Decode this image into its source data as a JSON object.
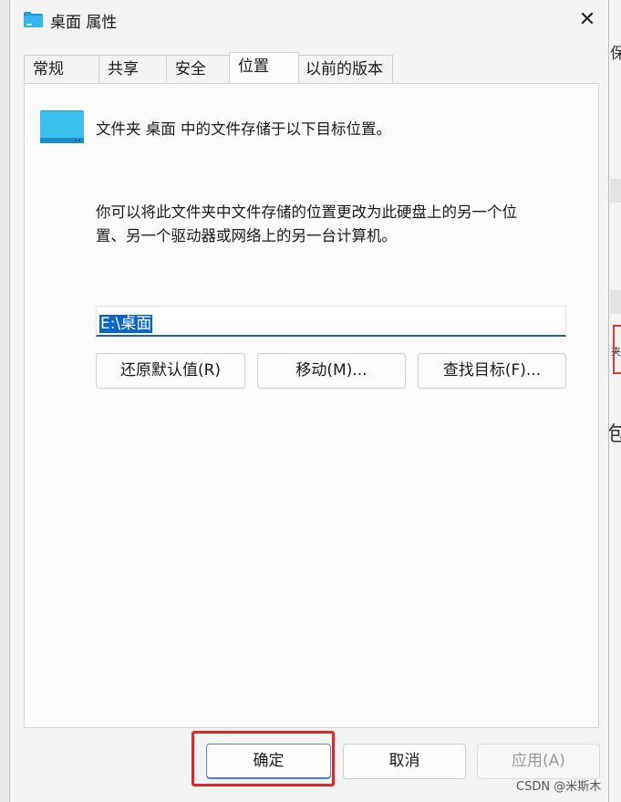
{
  "window": {
    "title": "桌面 属性",
    "close_symbol": "✕"
  },
  "tabs": [
    {
      "label": "常规"
    },
    {
      "label": "共享"
    },
    {
      "label": "安全"
    },
    {
      "label": "位置",
      "active": true
    },
    {
      "label": "以前的版本"
    }
  ],
  "location": {
    "line": "文件夹 桌面 中的文件存储于以下目标位置。",
    "description": "你可以将此文件夹中文件存储的位置更改为此硬盘上的另一个位置、另一个驱动器或网络上的另一台计算机。",
    "path_value": "E:\\桌面",
    "restore_label": "还原默认值(R)",
    "move_label": "移动(M)...",
    "find_label": "查找目标(F)..."
  },
  "footer": {
    "ok_label": "确定",
    "cancel_label": "取消",
    "apply_label": "应用(A)"
  },
  "background": {
    "glyph_top": "保",
    "glyph_mid": "包",
    "glyph_small": "夹"
  },
  "watermark": "CSDN @米斯木",
  "colors": {
    "accent": "#0a66c6",
    "highlight_red": "#e02626",
    "folder_blue": "#1e9bd7"
  }
}
